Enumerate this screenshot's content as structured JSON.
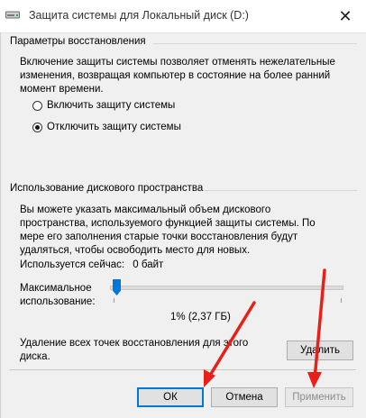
{
  "window": {
    "title": "Защита системы для Локальный диск (D:)",
    "close_glyph": "✕"
  },
  "restore": {
    "section_title": "Параметры восстановления",
    "description": "Включение защиты системы позволяет отменять нежелательные изменения, возвращая компьютер в состояние на более ранний момент времени.",
    "options": [
      {
        "label": "Включить защиту системы",
        "checked": false
      },
      {
        "label": "Отключить защиту системы",
        "checked": true
      }
    ]
  },
  "disk": {
    "section_title": "Использование дискового пространства",
    "description": "Вы можете указать максимальный объем дискового пространства, используемого функцией защиты системы. По мере его заполнения старые точки восстановления будут удаляться, чтобы освободить место для новых.",
    "current_usage_label": "Используется сейчас:",
    "current_usage_value": "0 байт",
    "max_usage_label": "Максимальное использование:",
    "slider_fraction": 0.01,
    "slider_value_text": "1% (2,37 ГБ)",
    "delete_text": "Удаление всех точек восстановления для этого диска.",
    "delete_button": "Удалить"
  },
  "footer": {
    "ok": "ОК",
    "cancel": "Отмена",
    "apply": "Применить"
  },
  "colors": {
    "accent": "#0078d7",
    "annotation_arrow": "#e8201a"
  }
}
